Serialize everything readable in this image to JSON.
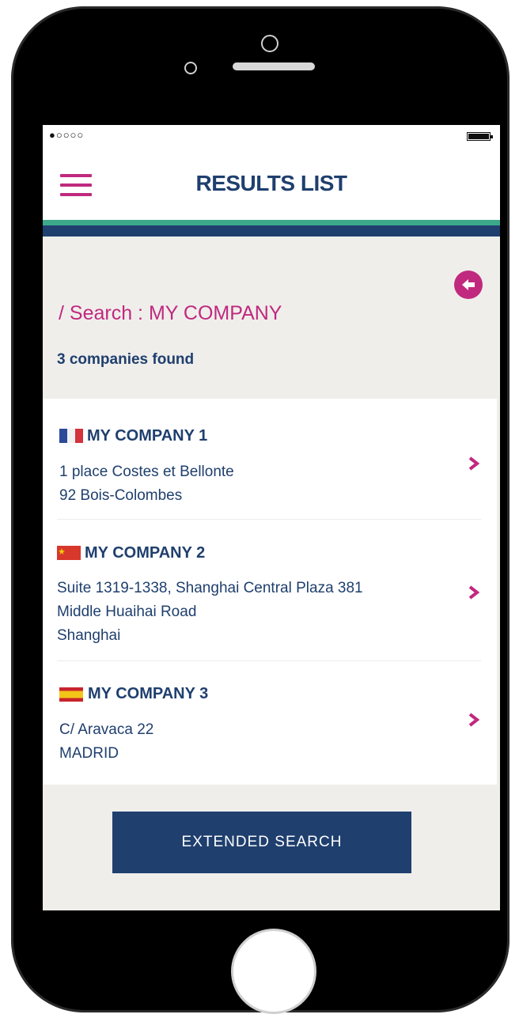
{
  "status_bar": {
    "signal": "●○○○○"
  },
  "header": {
    "title": "RESULTS LIST"
  },
  "search": {
    "title": "/ Search : MY COMPANY",
    "count_text": "3 companies found"
  },
  "results": [
    {
      "name": "MY COMPANY 1",
      "country_flag": "france",
      "address": [
        "1 place Costes et Bellonte",
        "92 Bois-Colombes"
      ]
    },
    {
      "name": "MY COMPANY 2",
      "country_flag": "china",
      "address": [
        "Suite 1319-1338, Shanghai Central Plaza 381",
        "Middle Huaihai Road",
        "Shanghai"
      ]
    },
    {
      "name": "MY COMPANY 3",
      "country_flag": "spain",
      "address": [
        "C/ Aravaca 22",
        "MADRID"
      ]
    }
  ],
  "actions": {
    "extended_search_label": "EXTENDED SEARCH"
  },
  "colors": {
    "brand_blue": "#1f3f6e",
    "accent_pink": "#c0297e",
    "stripe_green": "#3ba98a",
    "background": "#efeeeb"
  },
  "icons": {
    "menu": "hamburger-menu-icon",
    "back": "arrow-left-circle-icon",
    "row": "chevron-right-icon"
  }
}
